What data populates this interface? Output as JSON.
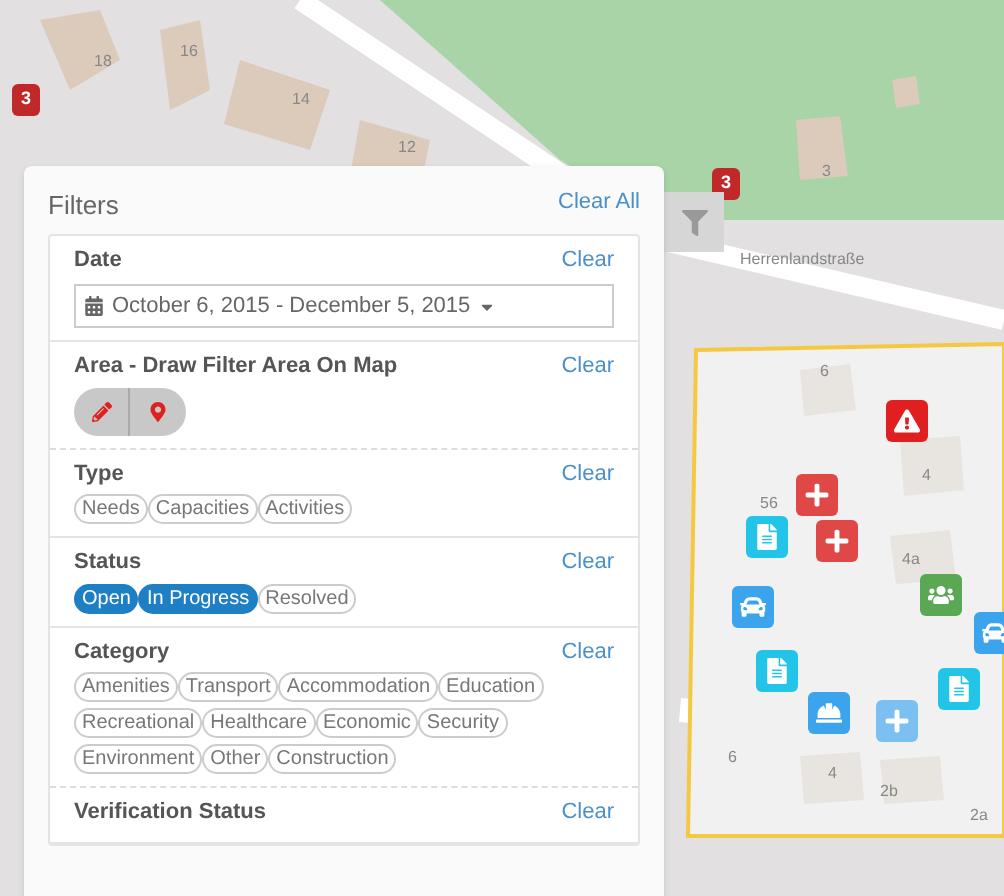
{
  "map": {
    "labels": [
      "18",
      "16",
      "14",
      "12",
      "3",
      "Herrenlandstraße",
      "6",
      "4",
      "4a",
      "56",
      "6",
      "4",
      "2b",
      "2a"
    ],
    "clusters": [
      "3",
      "3"
    ],
    "markers": [
      {
        "kind": "warning",
        "color": "#e02020"
      },
      {
        "kind": "plus",
        "color": "#e04848"
      },
      {
        "kind": "plus",
        "color": "#e04848"
      },
      {
        "kind": "document",
        "color": "#22c4e8"
      },
      {
        "kind": "car",
        "color": "#3ba4ec"
      },
      {
        "kind": "people",
        "color": "#5aa854"
      },
      {
        "kind": "car",
        "color": "#3ba4ec"
      },
      {
        "kind": "document",
        "color": "#22c4e8"
      },
      {
        "kind": "document",
        "color": "#22c4e8"
      },
      {
        "kind": "worker",
        "color": "#3ba4ec"
      },
      {
        "kind": "plus",
        "color": "#7cc0f2"
      }
    ]
  },
  "filters": {
    "title": "Filters",
    "clear_all": "Clear All",
    "date": {
      "label": "Date",
      "clear": "Clear",
      "value": "October 6, 2015 - December 5, 2015"
    },
    "area": {
      "label": "Area - Draw Filter Area On Map",
      "clear": "Clear"
    },
    "type": {
      "label": "Type",
      "clear": "Clear",
      "chips": [
        {
          "label": "Needs",
          "selected": false
        },
        {
          "label": "Capacities",
          "selected": false
        },
        {
          "label": "Activities",
          "selected": false
        }
      ]
    },
    "status": {
      "label": "Status",
      "clear": "Clear",
      "chips": [
        {
          "label": "Open",
          "selected": true
        },
        {
          "label": "In Progress",
          "selected": true
        },
        {
          "label": "Resolved",
          "selected": false
        }
      ]
    },
    "category": {
      "label": "Category",
      "clear": "Clear",
      "chips": [
        {
          "label": "Amenities",
          "selected": false
        },
        {
          "label": "Transport",
          "selected": false
        },
        {
          "label": "Accommodation",
          "selected": false
        },
        {
          "label": "Education",
          "selected": false
        },
        {
          "label": "Recreational",
          "selected": false
        },
        {
          "label": "Healthcare",
          "selected": false
        },
        {
          "label": "Economic",
          "selected": false
        },
        {
          "label": "Security",
          "selected": false
        },
        {
          "label": "Environment",
          "selected": false
        },
        {
          "label": "Other",
          "selected": false
        },
        {
          "label": "Construction",
          "selected": false
        }
      ]
    },
    "verification": {
      "label": "Verification Status",
      "clear": "Clear"
    }
  }
}
